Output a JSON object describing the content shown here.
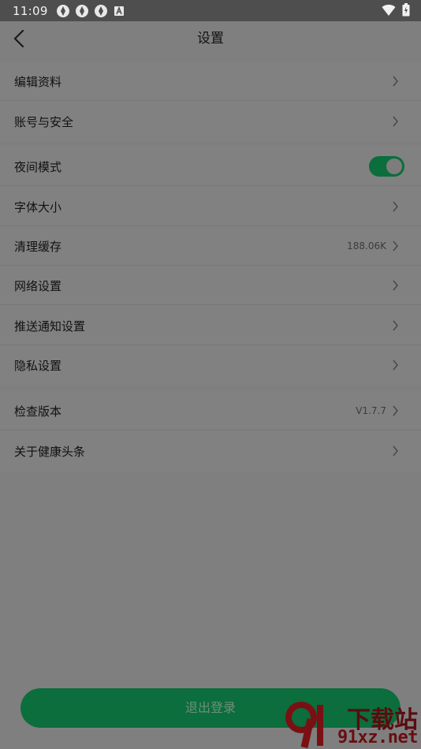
{
  "status_bar": {
    "time": "11:09"
  },
  "header": {
    "title": "设置"
  },
  "settings": {
    "edit_profile": "编辑资料",
    "account_security": "账号与安全",
    "night_mode": "夜间模式",
    "night_mode_on": true,
    "font_size": "字体大小",
    "clear_cache": "清理缓存",
    "cache_size": "188.06K",
    "network": "网络设置",
    "push": "推送通知设置",
    "privacy": "隐私设置",
    "check_version": "检查版本",
    "version": "V1.7.7",
    "about": "关于健康头条"
  },
  "logout_label": "退出登录",
  "watermark": {
    "brand": "下载站",
    "url": "91xz.net"
  },
  "colors": {
    "accent": "#0b6e3c",
    "overlay_background": "#7f7f7f"
  }
}
